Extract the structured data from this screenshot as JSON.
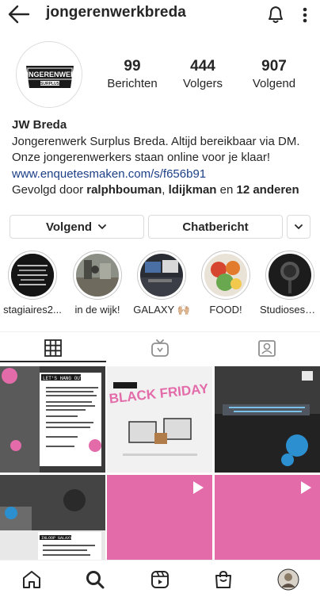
{
  "header": {
    "username": "jongerenwerkbreda",
    "back_icon": "arrow-left-icon",
    "bell_icon": "bell-icon",
    "more_icon": "more-vertical-icon"
  },
  "profile": {
    "avatar_text": "JONGERENWERK",
    "avatar_subtext": "SURPLUS",
    "stats": [
      {
        "value": "99",
        "label": "Berichten"
      },
      {
        "value": "444",
        "label": "Volgers"
      },
      {
        "value": "907",
        "label": "Volgend"
      }
    ],
    "name": "JW Breda",
    "bio_line1": "Jongerenwerk Surplus Breda. Altijd bereikbaar via DM.",
    "bio_line2": "Onze jongerenwerkers staan online voor je klaar!",
    "link": "www.enquetesmaken.com/s/f656b91",
    "followed_prefix": "Gevolgd door ",
    "followed_user1": "ralphbouman",
    "followed_sep": ", ",
    "followed_user2": "ldijkman",
    "followed_and": " en ",
    "followed_others": "12 anderen"
  },
  "buttons": {
    "follow_label": "Volgend",
    "message_label": "Chatbericht"
  },
  "highlights": [
    {
      "label": "stagiaires2..."
    },
    {
      "label": "in de wijk!"
    },
    {
      "label": "GALAXY 🙌🏼"
    },
    {
      "label": "FOOD!"
    },
    {
      "label": "Studiosessi..."
    }
  ],
  "tabs": [
    {
      "name": "grid-icon"
    },
    {
      "name": "igtv-icon"
    },
    {
      "name": "tagged-icon"
    }
  ],
  "posts": [
    {
      "title": "LET'S HANG OUT",
      "caption": "Ben jij op zoek naar een fun plek om met je vrienden te chillen in de omgeving van de Haagse Beemden? Vind je thuis bij Galaxy! Iedere donderdag 18:30 - 22:00",
      "footer": "Jongerenwerk Surplus Breda"
    },
    {
      "title": "BLACK FRIDAY",
      "caption": "",
      "footer": ""
    },
    {
      "title": "",
      "caption": "",
      "footer": ""
    },
    {
      "title": "INLOOP GALAXY",
      "caption": "Gezelig, muziek maken of gamen met vrienden?",
      "footer": ""
    },
    {
      "title": "",
      "caption": "",
      "footer": ""
    },
    {
      "title": "",
      "caption": "",
      "footer": ""
    }
  ],
  "bottom_nav": [
    {
      "name": "home-icon"
    },
    {
      "name": "search-icon"
    },
    {
      "name": "reels-icon"
    },
    {
      "name": "shop-icon"
    },
    {
      "name": "profile-avatar"
    }
  ],
  "colors": {
    "link": "#1c3f87",
    "pink": "#e36ba9",
    "text": "#262626",
    "border": "#dbdbdb"
  }
}
